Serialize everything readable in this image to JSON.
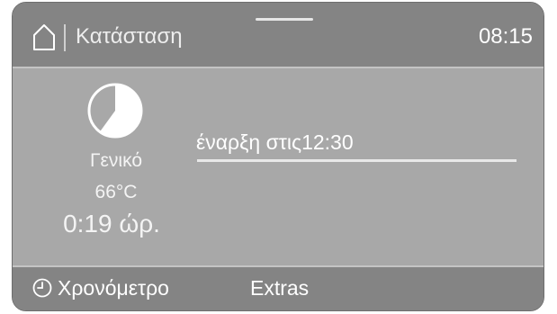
{
  "header": {
    "title": "Κατάσταση",
    "time": "08:15",
    "icons": {
      "home": "home-icon"
    }
  },
  "program": {
    "icon": "program-progress-icon",
    "progress_fraction": 0.6,
    "name": "Γενικό",
    "temperature": "66°C",
    "duration": "0:19 ώρ."
  },
  "start": {
    "text": "έναρξη στις12:30"
  },
  "footer": {
    "timer_label": "Χρονόμετρο",
    "timer_icon": "clock-icon",
    "extras_label": "Extras"
  },
  "colors": {
    "screen_bg": "#a8a8a8",
    "bar_bg": "#848484",
    "text": "#ffffff"
  }
}
